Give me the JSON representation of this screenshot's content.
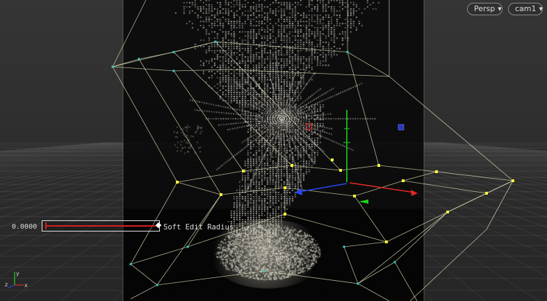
{
  "viewport": {
    "projection_label": "Persp",
    "camera_label": "cam1",
    "soft_edit": {
      "value": "0.0000",
      "label": "Soft Edit Radius"
    },
    "axes": {
      "x": "x",
      "y": "y",
      "z": "z"
    }
  },
  "icons": {
    "dropdown": "chevron-down-icon"
  },
  "colors": {
    "points": "#c8c5ba",
    "cage": "#e9ebc0",
    "handle": "#ffff3a",
    "x_axis": "#e02828",
    "y_axis": "#1fd21f",
    "z_axis": "#2b46f0",
    "slider": "#d61f1f"
  }
}
